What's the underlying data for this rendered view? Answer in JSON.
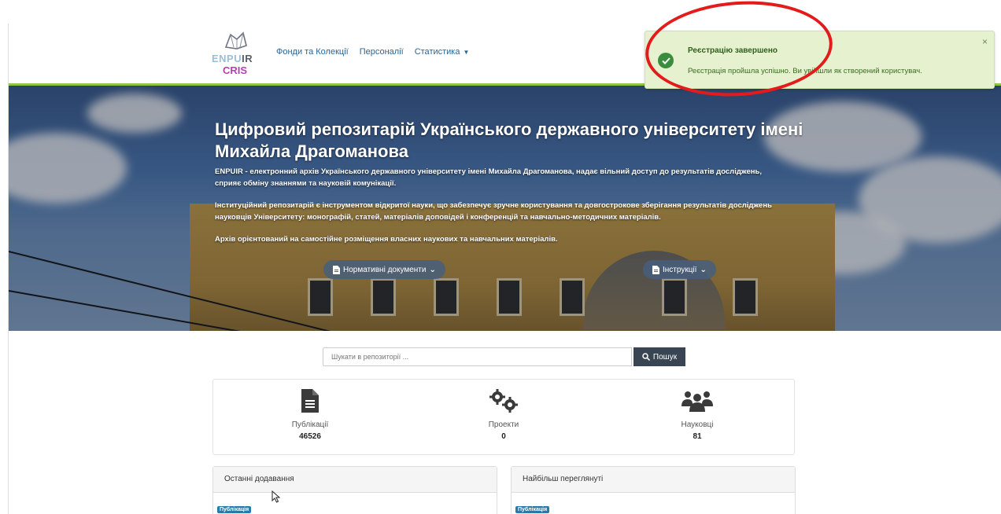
{
  "header": {
    "logo": {
      "top": "ENPUIR",
      "bottom": "CRIS"
    },
    "nav": [
      {
        "label": "Фонди та Колекції"
      },
      {
        "label": "Персоналії"
      },
      {
        "label": "Статистика",
        "has_dropdown": true
      }
    ]
  },
  "hero": {
    "title": "Цифровий репозитарій Українського державного університету імені Михайла Драгоманова",
    "paragraphs": [
      "ENPUIR - електронний архів Українського державного університету імені Михайла Драгоманова, надає вільний доступ до результатів досліджень, сприяє обміну знаннями та науковій комунікації.",
      "Інституційний репозитарій є інструментом відкритої науки, що забезпечує зручне користування та довгострокове зберігання результатів досліджень науковців Університету: монографій, статей, матеріалів доповідей і конференцій та навчально-методичних матеріалів.",
      "Архів орієнтований на самостійне розміщення власних наукових та навчальних матеріалів."
    ],
    "buttons": {
      "normative": "Нормативні документи",
      "instructions": "Інструкції"
    }
  },
  "search": {
    "placeholder": "Шукати в репозиторії ...",
    "button": "Пошук"
  },
  "stats": [
    {
      "icon": "document-icon",
      "label": "Публікації",
      "value": "46526"
    },
    {
      "icon": "gears-icon",
      "label": "Проекти",
      "value": "0"
    },
    {
      "icon": "users-icon",
      "label": "Науковці",
      "value": "81"
    }
  ],
  "panels": {
    "recent": {
      "title": "Останні додавання",
      "badge": "Публікація"
    },
    "most_viewed": {
      "title": "Найбільш переглянуті",
      "badge": "Публікація"
    }
  },
  "toast": {
    "title": "Реєстрацію завершено",
    "message": "Реєстрація пройшла успішно. Ви увійшли як створений користувач.",
    "close": "×",
    "color": "#e5f1cf"
  },
  "annotation": {
    "color": "#e41b1b"
  }
}
